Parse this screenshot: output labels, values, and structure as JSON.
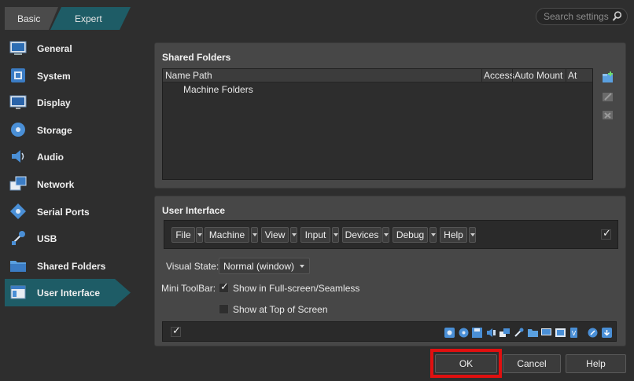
{
  "mode_tabs": {
    "basic": "Basic",
    "expert": "Expert"
  },
  "search": {
    "placeholder": "Search settings"
  },
  "sidebar": {
    "items": [
      {
        "label": "General",
        "icon": "general-icon"
      },
      {
        "label": "System",
        "icon": "system-icon"
      },
      {
        "label": "Display",
        "icon": "display-icon"
      },
      {
        "label": "Storage",
        "icon": "storage-icon"
      },
      {
        "label": "Audio",
        "icon": "audio-icon"
      },
      {
        "label": "Network",
        "icon": "network-icon"
      },
      {
        "label": "Serial Ports",
        "icon": "serial-ports-icon"
      },
      {
        "label": "USB",
        "icon": "usb-icon"
      },
      {
        "label": "Shared Folders",
        "icon": "shared-folders-icon"
      },
      {
        "label": "User Interface",
        "icon": "user-interface-icon"
      }
    ],
    "active": "User Interface"
  },
  "shared_folders": {
    "title": "Shared Folders",
    "columns": [
      "Name",
      "Path",
      "Access",
      "Auto Mount",
      "At"
    ],
    "rows": [
      "Machine Folders"
    ]
  },
  "user_interface": {
    "title": "User Interface",
    "menus": [
      "File",
      "Machine",
      "View",
      "Input",
      "Devices",
      "Debug",
      "Help"
    ],
    "menu_bar_enabled": true,
    "visual_state_label": "Visual State:",
    "visual_state_value": "Normal (window)",
    "mini_toolbar_label": "Mini ToolBar:",
    "mini_toolbar_fullscreen": "Show in Full-screen/Seamless",
    "mini_toolbar_fullscreen_checked": true,
    "mini_toolbar_top": "Show at Top of Screen",
    "mini_toolbar_top_checked": false,
    "status_bar_enabled": true
  },
  "buttons": {
    "ok": "OK",
    "cancel": "Cancel",
    "help": "Help"
  },
  "colors": {
    "highlight": "#1e5c66",
    "focus_frame": "#e01010",
    "background": "#2e2e2e"
  }
}
